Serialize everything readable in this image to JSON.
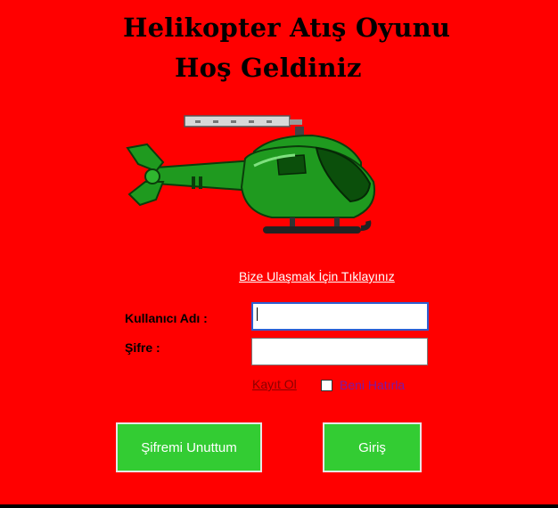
{
  "header": {
    "title": "Helikopter Atış Oyunu",
    "subtitle": "Hoş Geldiniz"
  },
  "contact": {
    "link_text": "Bize Ulaşmak İçin Tıklayınız"
  },
  "login": {
    "username_label": "Kullanıcı Adı :",
    "username_value": "",
    "password_label": "Şifre :",
    "password_value": "",
    "register_link": "Kayıt Ol",
    "remember_label": "Beni Hatırla",
    "remember_checked": false
  },
  "buttons": {
    "forgot_password": "Şifremi Unuttum",
    "login": "Giriş"
  },
  "icons": {
    "hero_image": "helicopter-icon"
  },
  "colors": {
    "background": "#ff0000",
    "button": "#33cc33",
    "button_text": "#ffffff",
    "contact_link": "#ffffff",
    "register_link": "#8b0000",
    "remember_label": "#7a1aa6",
    "helicopter_body": "#1f9a1f"
  }
}
